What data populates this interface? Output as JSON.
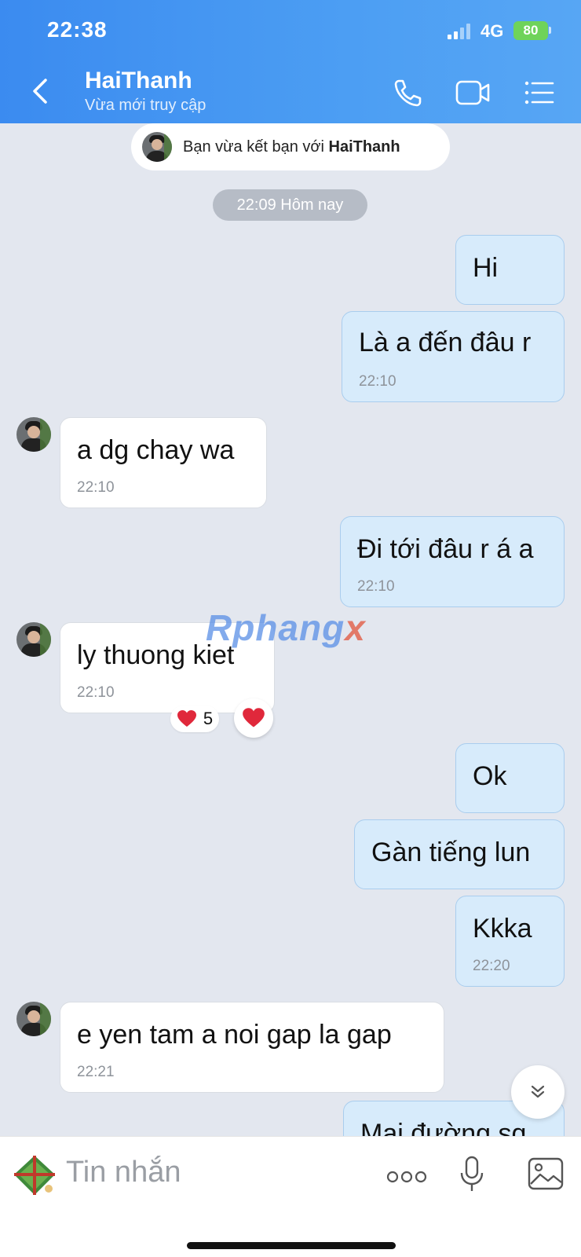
{
  "status_bar": {
    "time": "22:38",
    "network": "4G",
    "battery": "80"
  },
  "header": {
    "contact_name": "HaiThanh",
    "status": "Vừa mới truy cập"
  },
  "system": {
    "friend_notice_prefix": "Bạn vừa kết bạn với ",
    "friend_notice_name": "HaiThanh",
    "date_separator": "22:09 Hôm nay"
  },
  "messages": [
    {
      "side": "sent",
      "text": "Hi",
      "time": ""
    },
    {
      "side": "sent",
      "text": "Là a đến đâu r",
      "time": "22:10"
    },
    {
      "side": "received",
      "text": "a dg chay wa",
      "time": "22:10"
    },
    {
      "side": "sent",
      "text": "Đi tới đâu r á a",
      "time": "22:10"
    },
    {
      "side": "received",
      "text": "ly thuong kiet",
      "time": "22:10"
    },
    {
      "side": "sent",
      "text": "Ok",
      "time": ""
    },
    {
      "side": "sent",
      "text": "Gàn tiếng lun",
      "time": ""
    },
    {
      "side": "sent",
      "text": "Kkka",
      "time": "22:20"
    },
    {
      "side": "received",
      "text": "e yen tam a noi gap la gap",
      "time": "22:21"
    },
    {
      "side": "sent",
      "text": "Mai đường sq",
      "time": ""
    }
  ],
  "reaction": {
    "count": "5",
    "emoji": "heart"
  },
  "watermark": {
    "main": "Rphang",
    "accent": "x"
  },
  "composer": {
    "placeholder": "Tin nhắn"
  },
  "colors": {
    "header_blue": "#3b8bf0",
    "sent_bubble": "#d7ebfb",
    "chat_bg": "#e3e7ef",
    "reaction_red": "#e0283b"
  }
}
